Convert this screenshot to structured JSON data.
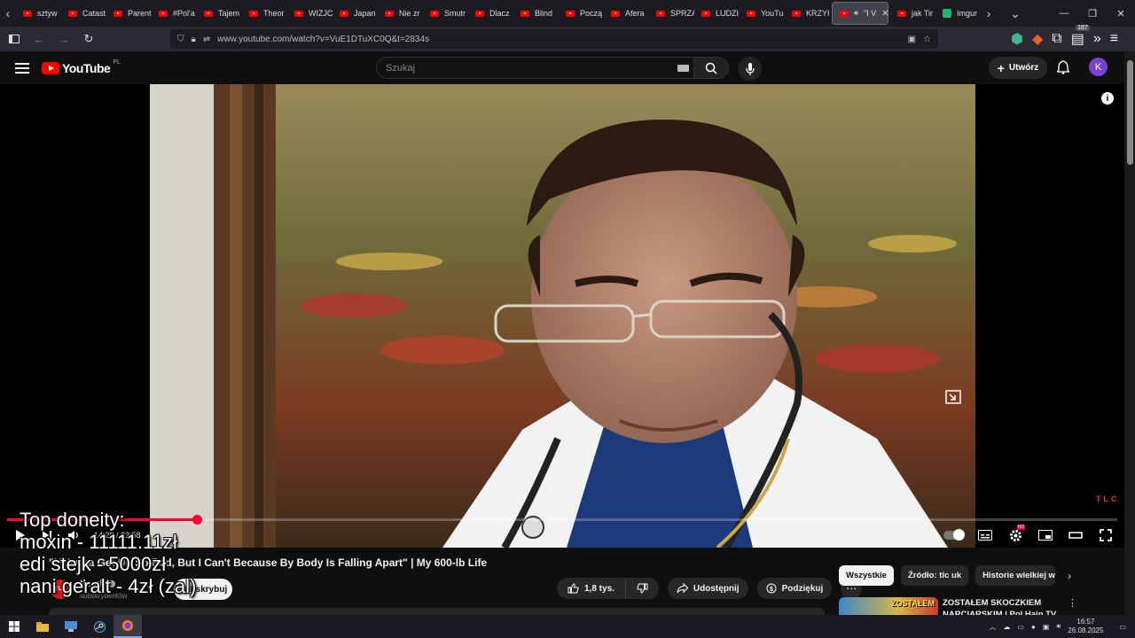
{
  "browser": {
    "tabs": [
      {
        "label": "sztyw",
        "type": "yt"
      },
      {
        "label": "Catast",
        "type": "yt"
      },
      {
        "label": "Parent",
        "type": "yt"
      },
      {
        "label": "#Pol'a",
        "type": "yt"
      },
      {
        "label": "Tajem",
        "type": "yt"
      },
      {
        "label": "Theor",
        "type": "yt"
      },
      {
        "label": "WIZJC",
        "type": "yt"
      },
      {
        "label": "Japan",
        "type": "yt"
      },
      {
        "label": "Nie zr",
        "type": "yt"
      },
      {
        "label": "Smutr",
        "type": "yt"
      },
      {
        "label": "Dlacz",
        "type": "yt"
      },
      {
        "label": "Blind",
        "type": "yt"
      },
      {
        "label": "Począ",
        "type": "yt"
      },
      {
        "label": "Afera",
        "type": "yt"
      },
      {
        "label": "SPRZA",
        "type": "yt"
      },
      {
        "label": "LUDZI",
        "type": "yt"
      },
      {
        "label": "YouTu",
        "type": "yt"
      },
      {
        "label": "KRZYI",
        "type": "yt"
      }
    ],
    "active_tab": {
      "label": "\"I V",
      "close": "✕"
    },
    "after_tabs": [
      {
        "label": "jak Tir",
        "type": "yt"
      },
      {
        "label": "Imgur",
        "type": "imgur"
      }
    ],
    "url": "www.youtube.com/watch?v=VuE1DTuXC0Q&t=2834s",
    "notification_count": "187"
  },
  "masthead": {
    "logo_text": "YouTube",
    "region": "PL",
    "search_placeholder": "Szukaj",
    "create_label": "Utwórz",
    "avatar_letter": "K"
  },
  "player": {
    "time_current": "14:28",
    "time_total": "23:58",
    "watermark": "TLC",
    "progress_fraction": 0.1707,
    "hd_badge": "HD"
  },
  "video": {
    "title": "\"I Wanna Get Up So Bad, But I Can't Because By Body Is Falling Apart\" | My 600-lb Life",
    "channel": "tlc uk",
    "channel_avatar_text": "TLC",
    "subscribers": "subskrybentów",
    "subscribe_label": "Subskrybuj",
    "likes": "1,8 tys.",
    "share_label": "Udostępnij",
    "thanks_label": "Podziękuj"
  },
  "sidebar": {
    "chips": [
      "Wszystkie",
      "Źródło: tlc uk",
      "Historie wielkiej wagi"
    ],
    "recommendation": {
      "thumb_text": "ZOSTAŁEM",
      "title": "ZOSTAŁEM SKOCZKIEM NARCIARSKIM | Pol Hain TV"
    }
  },
  "overlay": {
    "lines": [
      "Top doneity:",
      "moxin - 11111.11zł",
      "edi stejk - 5000zł",
      "nani geralt - 4zł (zal)"
    ]
  },
  "taskbar": {
    "time": "16:57",
    "date": "26.08.2025"
  },
  "colors": {
    "yt_red": "#ff0000",
    "progress_red": "#ff0033",
    "avatar_purple": "#7b3fd6"
  }
}
